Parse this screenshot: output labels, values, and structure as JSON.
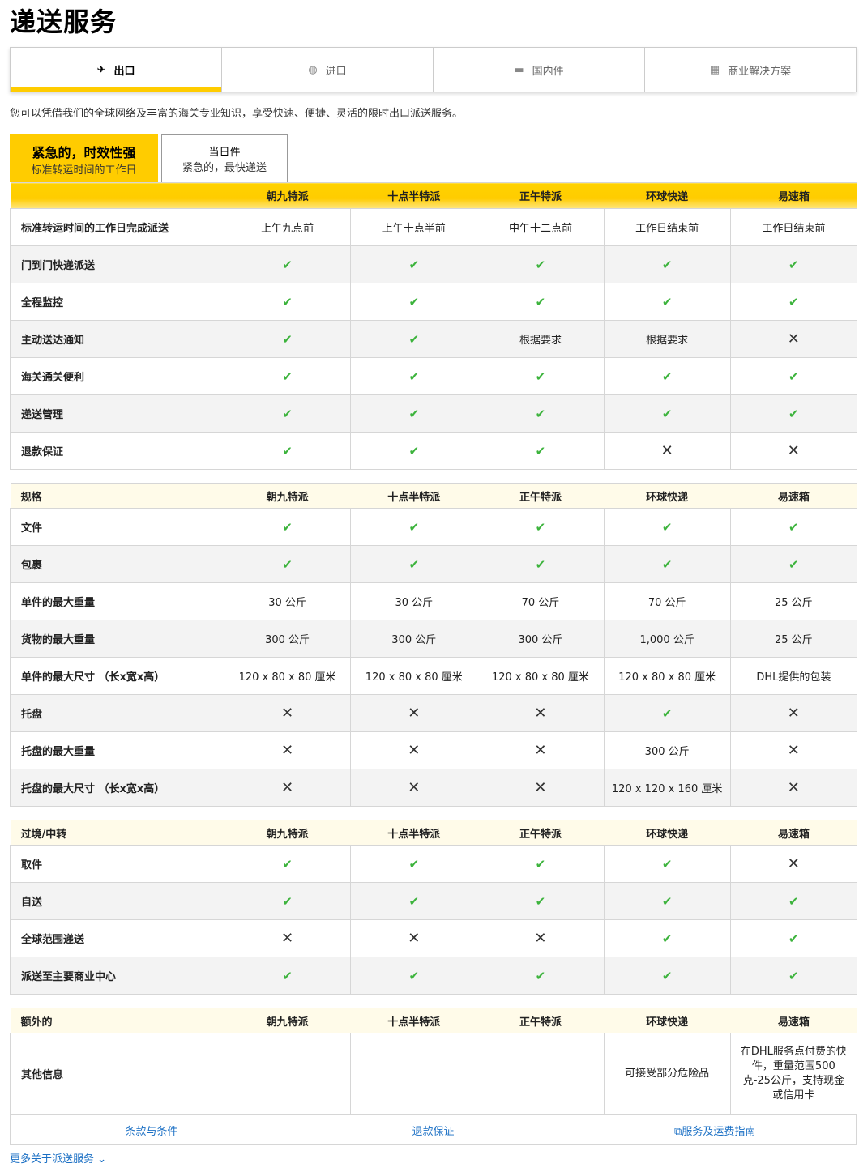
{
  "page_title": "递送服务",
  "main_tabs": [
    {
      "label": "出口",
      "icon": "plane-icon",
      "glyph": "✈"
    },
    {
      "label": "进口",
      "icon": "globe-icon",
      "glyph": "◍"
    },
    {
      "label": "国内件",
      "icon": "truck-icon",
      "glyph": "▬"
    },
    {
      "label": "商业解决方案",
      "icon": "boxes-icon",
      "glyph": "▦"
    }
  ],
  "intro": "您可以凭借我们的全球网络及丰富的海关专业知识，享受快速、便捷、灵活的限时出口派送服务。",
  "sub_tabs": [
    {
      "title": "紧急的，时效性强",
      "subtitle": "标准转运时间的工作日"
    },
    {
      "title": "当日件",
      "subtitle": "紧急的，最快递送"
    }
  ],
  "columns": [
    "朝九特派",
    "十点半特派",
    "正午特派",
    "环球快递",
    "易速箱"
  ],
  "sections": [
    {
      "header": "",
      "rows": [
        {
          "label": "标准转运时间的工作日完成派送",
          "cells": [
            "上午九点前",
            "上午十点半前",
            "中午十二点前",
            "工作日结束前",
            "工作日结束前"
          ]
        },
        {
          "label": "门到门快递派送",
          "cells": [
            "yes",
            "yes",
            "yes",
            "yes",
            "yes"
          ]
        },
        {
          "label": "全程监控",
          "cells": [
            "yes",
            "yes",
            "yes",
            "yes",
            "yes"
          ]
        },
        {
          "label": "主动送达通知",
          "cells": [
            "yes",
            "yes",
            "根据要求",
            "根据要求",
            "no"
          ]
        },
        {
          "label": "海关通关便利",
          "cells": [
            "yes",
            "yes",
            "yes",
            "yes",
            "yes"
          ]
        },
        {
          "label": "递送管理",
          "cells": [
            "yes",
            "yes",
            "yes",
            "yes",
            "yes"
          ]
        },
        {
          "label": "退款保证",
          "cells": [
            "yes",
            "yes",
            "yes",
            "no",
            "no"
          ]
        }
      ]
    },
    {
      "header": "规格",
      "rows": [
        {
          "label": "文件",
          "cells": [
            "yes",
            "yes",
            "yes",
            "yes",
            "yes"
          ]
        },
        {
          "label": "包裹",
          "cells": [
            "yes",
            "yes",
            "yes",
            "yes",
            "yes"
          ]
        },
        {
          "label": "单件的最大重量",
          "cells": [
            "30 公斤",
            "30 公斤",
            "70 公斤",
            "70 公斤",
            "25 公斤"
          ]
        },
        {
          "label": "货物的最大重量",
          "cells": [
            "300 公斤",
            "300 公斤",
            "300 公斤",
            "1,000 公斤",
            "25 公斤"
          ]
        },
        {
          "label": "单件的最大尺寸 （长x宽x高）",
          "cells": [
            "120 x 80 x 80 厘米",
            "120 x 80 x 80 厘米",
            "120 x 80 x 80 厘米",
            "120 x 80 x 80 厘米",
            "DHL提供的包装"
          ]
        },
        {
          "label": "托盘",
          "cells": [
            "no",
            "no",
            "no",
            "yes",
            "no"
          ]
        },
        {
          "label": "托盘的最大重量",
          "cells": [
            "no",
            "no",
            "no",
            "300 公斤",
            "no"
          ]
        },
        {
          "label": "托盘的最大尺寸 （长x宽x高）",
          "cells": [
            "no",
            "no",
            "no",
            "120 x 120 x 160 厘米",
            "no"
          ]
        }
      ]
    },
    {
      "header": "过境/中转",
      "rows": [
        {
          "label": "取件",
          "cells": [
            "yes",
            "yes",
            "yes",
            "yes",
            "no"
          ]
        },
        {
          "label": "自送",
          "cells": [
            "yes",
            "yes",
            "yes",
            "yes",
            "yes"
          ]
        },
        {
          "label": "全球范围递送",
          "cells": [
            "no",
            "no",
            "no",
            "yes",
            "yes"
          ]
        },
        {
          "label": "派送至主要商业中心",
          "cells": [
            "yes",
            "yes",
            "yes",
            "yes",
            "yes"
          ]
        }
      ]
    },
    {
      "header": "额外的",
      "rows": [
        {
          "label": "其他信息",
          "cells": [
            "",
            "",
            "",
            "可接受部分危险品",
            "在DHL服务点付费的快件，重量范围500克-25公斤，支持现金或信用卡"
          ],
          "tall": true
        }
      ]
    }
  ],
  "footer_links": [
    "条款与条件",
    "退款保证",
    "服务及运费指南"
  ],
  "more_link": "更多关于派送服务",
  "colors": {
    "accent": "#ffcc00",
    "check": "#3cb33c",
    "link": "#1a6fc4"
  }
}
